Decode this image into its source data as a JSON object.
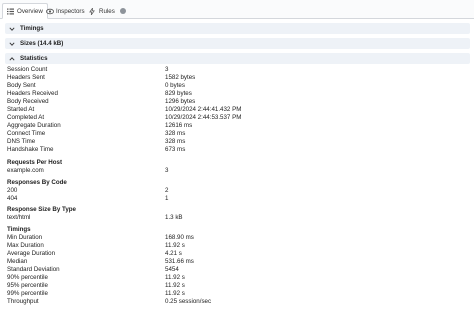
{
  "tabs": [
    {
      "label": "Overview",
      "icon": "list-icon",
      "active": true
    },
    {
      "label": "Inspectors",
      "icon": "eye-icon",
      "active": false
    },
    {
      "label": "Rules",
      "icon": "bolt-icon",
      "active": false
    }
  ],
  "sections": {
    "timings": "Timings",
    "sizes": "Sizes (14.4 kB)",
    "statistics": "Statistics"
  },
  "statistics": [
    {
      "label": "Session Count",
      "value": "3"
    },
    {
      "label": "Headers Sent",
      "value": "1582 bytes"
    },
    {
      "label": "Body Sent",
      "value": "0 bytes"
    },
    {
      "label": "Headers Received",
      "value": "829 bytes"
    },
    {
      "label": "Body Received",
      "value": "1296 bytes"
    },
    {
      "label": "Started At",
      "value": "10/29/2024 2:44:41.432 PM"
    },
    {
      "label": "Completed At",
      "value": "10/29/2024 2:44:53.537 PM"
    },
    {
      "label": "Aggregate Duration",
      "value": "12616 ms"
    },
    {
      "label": "Connect Time",
      "value": "328 ms"
    },
    {
      "label": "DNS Time",
      "value": "328 ms"
    },
    {
      "label": "Handshake Time",
      "value": "673 ms"
    }
  ],
  "requests_per_host": {
    "title": "Requests Per Host",
    "rows": [
      {
        "label": "example.com",
        "value": "3"
      }
    ]
  },
  "responses_by_code": {
    "title": "Responses By Code",
    "rows": [
      {
        "label": "200",
        "value": "2"
      },
      {
        "label": "404",
        "value": "1"
      }
    ]
  },
  "response_size_by_type": {
    "title": "Response Size By Type",
    "rows": [
      {
        "label": "text/html",
        "value": "1.3 kB"
      }
    ]
  },
  "timings_detail": {
    "title": "Timings",
    "rows": [
      {
        "label": "Min Duration",
        "value": "168.90 ms"
      },
      {
        "label": "Max Duration",
        "value": "11.92 s"
      },
      {
        "label": "Average Duration",
        "value": "4.21 s"
      },
      {
        "label": "Median",
        "value": "531.66 ms"
      },
      {
        "label": "Standard Deviation",
        "value": "5454"
      },
      {
        "label": "90% percentile",
        "value": "11.92 s"
      },
      {
        "label": "95% percentile",
        "value": "11.92 s"
      },
      {
        "label": "99% percentile",
        "value": "11.92 s"
      },
      {
        "label": "Throughput",
        "value": "0.25 session/sec"
      }
    ]
  },
  "colors": {
    "section_bg": "#eef2f7",
    "border": "#d4d7dc"
  }
}
